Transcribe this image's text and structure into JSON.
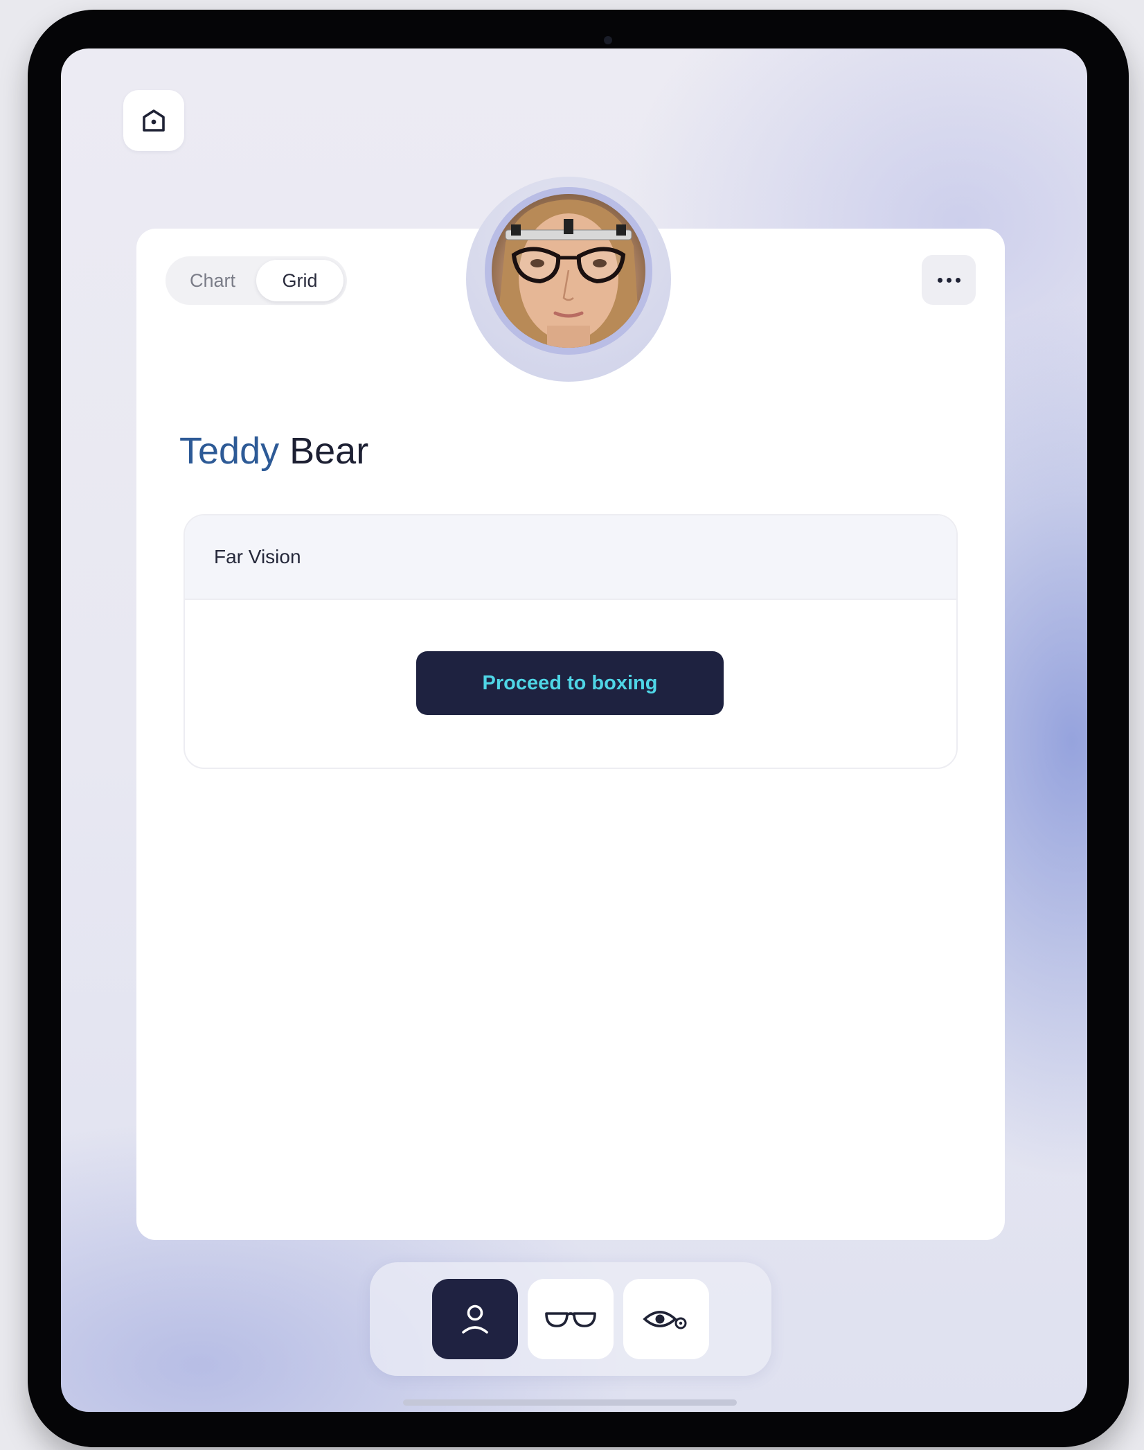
{
  "header": {
    "home_button": {
      "icon": "home-icon"
    },
    "more_button": {
      "icon": "more-horizontal-icon"
    }
  },
  "view_toggle": {
    "options": [
      {
        "label": "Chart",
        "selected": false
      },
      {
        "label": "Grid",
        "selected": true
      }
    ]
  },
  "patient": {
    "first_name": "Teddy",
    "last_name": "Bear",
    "avatar": "patient-photo"
  },
  "far_vision_panel": {
    "title": "Far Vision",
    "action_label": "Proceed to boxing"
  },
  "bottom_nav": {
    "items": [
      {
        "icon": "user-icon",
        "active": true
      },
      {
        "icon": "glasses-icon",
        "active": false
      },
      {
        "icon": "eye-settings-icon",
        "active": false
      }
    ]
  },
  "colors": {
    "primary_dark": "#1e2240",
    "accent_cyan": "#4fd6e6",
    "name_blue": "#2d5a96"
  }
}
